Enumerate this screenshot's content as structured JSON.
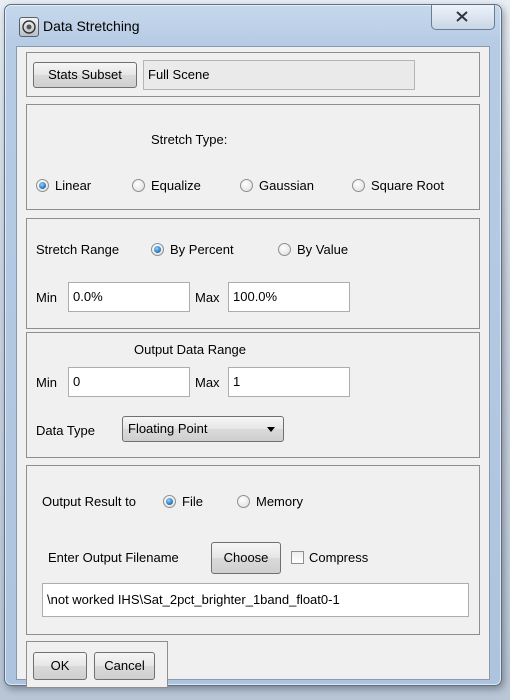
{
  "window": {
    "title": "Data Stretching"
  },
  "stats": {
    "button": "Stats Subset",
    "value": "Full Scene"
  },
  "stretch_type": {
    "heading": "Stretch Type:",
    "options": [
      "Linear",
      "Equalize",
      "Gaussian",
      "Square Root"
    ],
    "selected": "Linear"
  },
  "stretch_range": {
    "label": "Stretch Range",
    "options": [
      "By Percent",
      "By Value"
    ],
    "selected": "By Percent",
    "min_label": "Min",
    "min_value": "0.0%",
    "max_label": "Max",
    "max_value": "100.0%"
  },
  "output_range": {
    "heading": "Output Data Range",
    "min_label": "Min",
    "min_value": "0",
    "max_label": "Max",
    "max_value": "1",
    "data_type_label": "Data Type",
    "data_type_value": "Floating Point"
  },
  "output": {
    "result_label": "Output Result to",
    "options": [
      "File",
      "Memory"
    ],
    "selected": "File",
    "filename_label": "Enter Output Filename",
    "choose_button": "Choose",
    "compress_label": "Compress",
    "compress_checked": false,
    "filename_value": "\\not worked IHS\\Sat_2pct_brighter_1band_float0-1"
  },
  "buttons": {
    "ok": "OK",
    "cancel": "Cancel"
  },
  "icons": {
    "app": "app-icon",
    "close": "close-icon",
    "dropdown": "chevron-down-icon"
  }
}
